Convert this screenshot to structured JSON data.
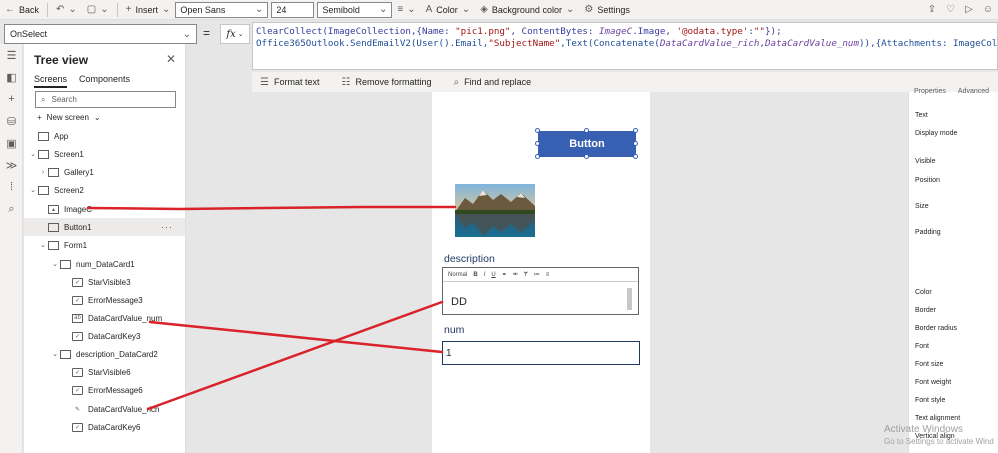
{
  "toolbar": {
    "back_label": "Back",
    "insert_label": "Insert",
    "font_family": "Open Sans",
    "font_size": "24",
    "font_weight": "Semibold",
    "color_label": "Color",
    "background_color_label": "Background color",
    "settings_label": "Settings"
  },
  "property_bar": {
    "selected_property": "OnSelect",
    "equals": "=",
    "fx_label": "fx"
  },
  "formula": {
    "line1_parts": [
      "ClearCollect(ImageCollection,{Name: ",
      "\"pic1.png\"",
      ", ContentBytes: ",
      "ImageC",
      ".Image, ",
      "'@odata.type'",
      ":",
      "\"\"",
      "});"
    ],
    "line2_parts": [
      "Office365Outlook.SendEmailV2(User().Email,",
      "\"SubjectName\"",
      ",Text(Concatenate(",
      "DataCardValue_rich",
      ",",
      "DataCardValue_num",
      ")),{Attachments: ImageCollection, IsHtml:true})"
    ]
  },
  "format_bar": {
    "format_text": "Format text",
    "remove_formatting": "Remove formatting",
    "find_replace": "Find and replace"
  },
  "tree_view": {
    "title": "Tree view",
    "tabs": [
      "Screens",
      "Components"
    ],
    "search_placeholder": "Search",
    "new_screen": "New screen",
    "items": [
      {
        "label": "App",
        "indent": 0,
        "icon": "app-icon"
      },
      {
        "label": "Screen1",
        "indent": 0,
        "icon": "screen-icon",
        "chevron": "down"
      },
      {
        "label": "Gallery1",
        "indent": 1,
        "icon": "gallery-icon",
        "chevron": "right"
      },
      {
        "label": "Screen2",
        "indent": 0,
        "icon": "screen-icon",
        "chevron": "down"
      },
      {
        "label": "ImageC",
        "indent": 1,
        "icon": "image-icon"
      },
      {
        "label": "Button1",
        "indent": 1,
        "icon": "button-icon",
        "selected": true
      },
      {
        "label": "Form1",
        "indent": 1,
        "icon": "form-icon",
        "chevron": "down"
      },
      {
        "label": "num_DataCard1",
        "indent": 2,
        "icon": "card-icon",
        "chevron": "down"
      },
      {
        "label": "StarVisible3",
        "indent": 3,
        "icon": "label-icon"
      },
      {
        "label": "ErrorMessage3",
        "indent": 3,
        "icon": "label-icon"
      },
      {
        "label": "DataCardValue_num",
        "indent": 3,
        "icon": "textinput-icon"
      },
      {
        "label": "DataCardKey3",
        "indent": 3,
        "icon": "label-icon"
      },
      {
        "label": "description_DataCard2",
        "indent": 2,
        "icon": "card-icon",
        "chevron": "down"
      },
      {
        "label": "StarVisible6",
        "indent": 3,
        "icon": "label-icon"
      },
      {
        "label": "ErrorMessage6",
        "indent": 3,
        "icon": "label-icon"
      },
      {
        "label": "DataCardValue_rich",
        "indent": 3,
        "icon": "richtext-icon"
      },
      {
        "label": "DataCardKey6",
        "indent": 3,
        "icon": "label-icon"
      }
    ]
  },
  "canvas": {
    "button_text": "Button",
    "description_label": "description",
    "rte_style": "Normal",
    "rte_text": "DD",
    "num_label": "num",
    "num_value": "1"
  },
  "properties_pane": {
    "tabs": [
      "Properties",
      "Advanced"
    ],
    "rows": [
      "Text",
      "Display mode",
      "Visible",
      "Position",
      "Size",
      "Padding",
      "Color",
      "Border",
      "Border radius",
      "Font",
      "Font size",
      "Font weight",
      "Font style",
      "Text alignment",
      "Vertical align"
    ]
  },
  "watermark": {
    "line1": "Activate Windows",
    "line2": "Go to Settings to activate Wind"
  },
  "colors": {
    "button_bg": "#3860b2",
    "annotation": "#d9222a",
    "label_text": "#1f3864"
  }
}
